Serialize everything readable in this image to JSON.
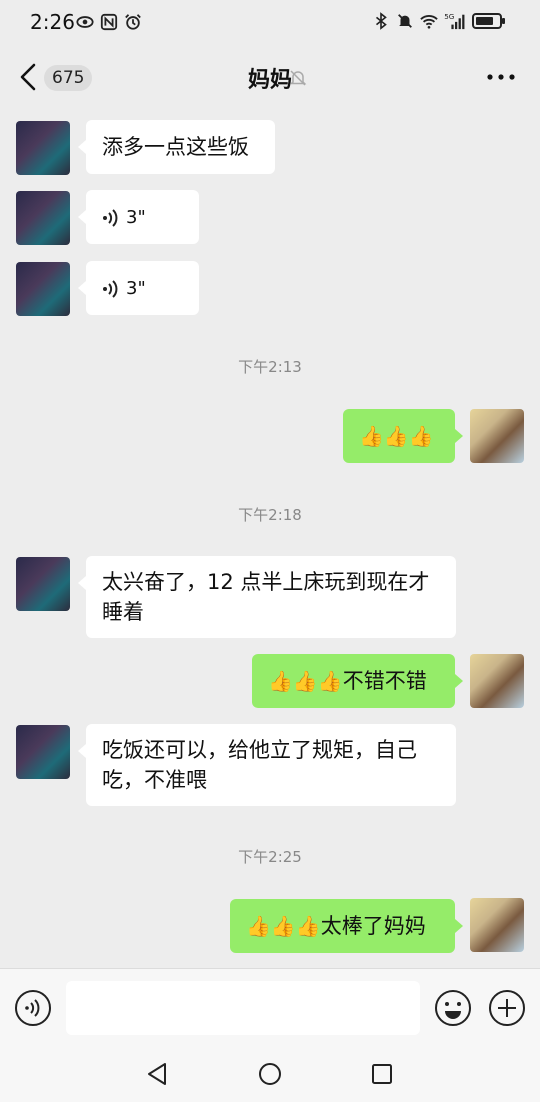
{
  "status_bar": {
    "time": "2:26",
    "network_label": "5G"
  },
  "nav": {
    "unread_count": "675",
    "title": "妈妈"
  },
  "messages": [
    {
      "type": "text",
      "from": "mom",
      "text": "添多一点这些饭"
    },
    {
      "type": "voice",
      "from": "mom",
      "duration": "3\""
    },
    {
      "type": "voice",
      "from": "mom",
      "duration": "3\""
    },
    {
      "type": "time",
      "text": "下午2:13"
    },
    {
      "type": "text",
      "from": "me",
      "text": "👍👍👍"
    },
    {
      "type": "time",
      "text": "下午2:18"
    },
    {
      "type": "text",
      "from": "mom",
      "line1": "太兴奋了，12 点半上床玩到现在才",
      "line2": "睡着"
    },
    {
      "type": "text",
      "from": "me",
      "emojis": "👍👍👍",
      "text": "不错不错"
    },
    {
      "type": "text",
      "from": "mom",
      "line1": "吃饭还可以，给他立了规矩，自己",
      "line2": "吃，不准喂"
    },
    {
      "type": "time",
      "text": "下午2:25"
    },
    {
      "type": "text",
      "from": "me",
      "emojis": "👍👍👍",
      "text": "太棒了妈妈"
    }
  ],
  "colors": {
    "background": "#ededed",
    "bubble_in": "#ffffff",
    "bubble_out": "#95ec69"
  },
  "icons": {
    "back": "chevron-left-icon",
    "mute": "bell-off-icon",
    "more": "more-dots-icon",
    "voice": "voice-input-icon",
    "emoji": "smiley-icon",
    "plus": "plus-circle-icon"
  }
}
